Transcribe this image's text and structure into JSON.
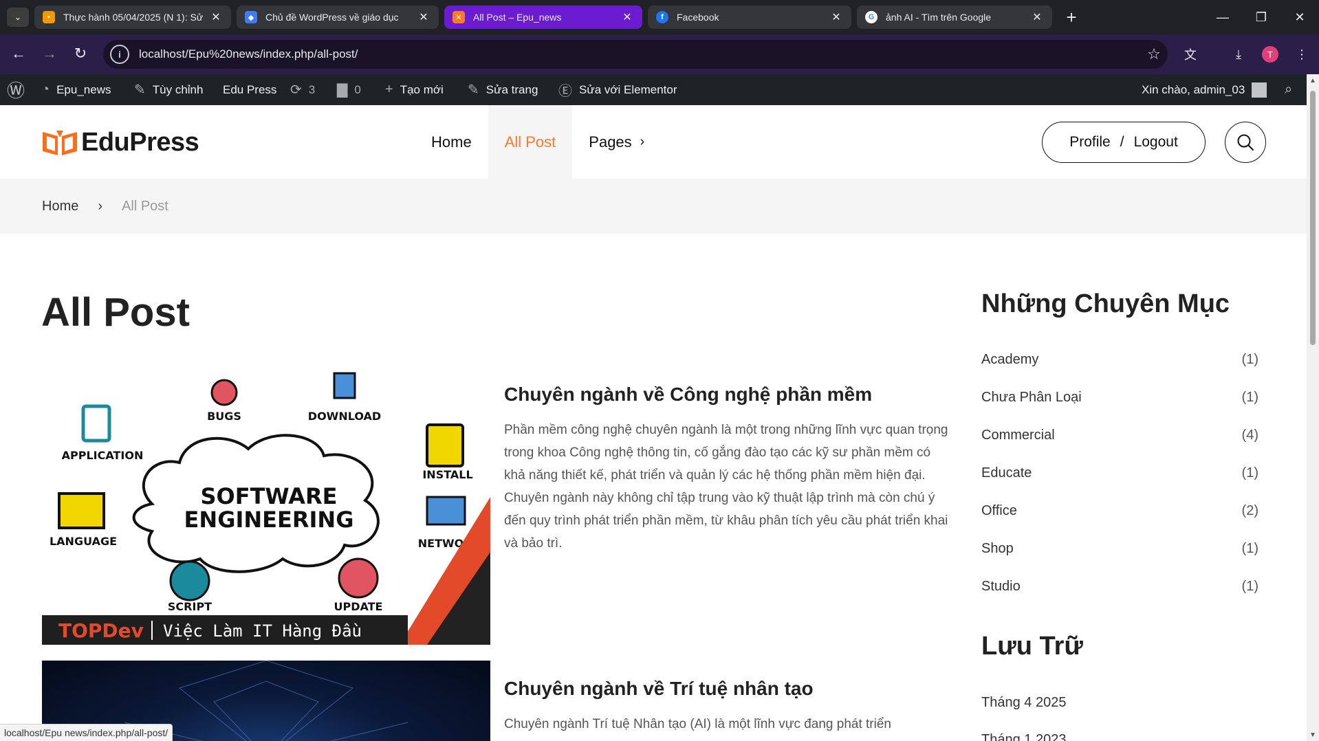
{
  "browser": {
    "tabs": [
      {
        "title": "Thực hành 05/04/2025 (N 1): Sử",
        "favicon": "slides-icon",
        "color": "#f29900"
      },
      {
        "title": "Chủ đề WordPress về giáo dục",
        "favicon": "shield-icon",
        "color": "#3d7cf2"
      },
      {
        "title": "All Post – Epu_news",
        "favicon": "xampp-icon",
        "color": "#fb7a24"
      },
      {
        "title": "Facebook",
        "favicon": "facebook-icon",
        "color": "#1877f2"
      },
      {
        "title": "ảnh AI - Tìm trên Google",
        "favicon": "google-icon",
        "color": "#ffffff"
      }
    ],
    "url": "localhost/Epu%20news/index.php/all-post/",
    "profile_initial": "T",
    "status_url": "localhost/Epu news/index.php/all-post/"
  },
  "adminbar": {
    "site_name": "Epu_news",
    "customize": "Tùy chỉnh",
    "theme": "Edu Press",
    "updates": "3",
    "comments": "0",
    "new": "Tạo mới",
    "edit": "Sửa trang",
    "elementor": "Sửa với Elementor",
    "greeting": "Xin chào, admin_03"
  },
  "header": {
    "logo": "EduPress",
    "nav": [
      "Home",
      "All Post",
      "Pages"
    ],
    "profile": "Profile",
    "slash": "/",
    "logout": "Logout"
  },
  "breadcrumb": {
    "home": "Home",
    "current": "All Post"
  },
  "page_title": "All Post",
  "posts": [
    {
      "title": "Chuyên ngành về Công nghệ phần mềm",
      "excerpt": "Phần mềm công nghệ chuyên ngành là một trong những lĩnh vực quan trọng trong khoa Công nghệ thông tin, cố gắng đào tạo các kỹ sư phần mềm có khả năng thiết kế, phát triển và quản lý các hệ thống phần mềm hiện đại. Chuyên ngành này không chỉ tập trung vào kỹ thuật lập trình mà còn chú ý đến quy trình phát triển phần mềm, từ khâu phân tích yêu cầu phát triển khai và bảo trì.",
      "image": {
        "center_line1": "SOFTWARE",
        "center_line2": "ENGINEERING",
        "labels": [
          "BUGS",
          "DOWNLOAD",
          "APPLICATION",
          "INSTALL",
          "LANGUAGE",
          "NETWO",
          "SCRIPT",
          "UPDATE"
        ],
        "brand": "TOPDev",
        "tagline": "Việc Làm IT Hàng Đầu"
      }
    },
    {
      "title": "Chuyên ngành về Trí tuệ nhân tạo",
      "excerpt": "Chuyên ngành Trí tuệ Nhân tạo (AI) là một lĩnh vực đang phát triển"
    }
  ],
  "sidebar": {
    "categories_title": "Những Chuyên Mục",
    "categories": [
      {
        "name": "Academy",
        "count": "(1)"
      },
      {
        "name": "Chưa Phân Loại",
        "count": "(1)"
      },
      {
        "name": "Commercial",
        "count": "(4)"
      },
      {
        "name": "Educate",
        "count": "(1)"
      },
      {
        "name": "Office",
        "count": "(2)"
      },
      {
        "name": "Shop",
        "count": "(1)"
      },
      {
        "name": "Studio",
        "count": "(1)"
      }
    ],
    "archive_title": "Lưu Trữ",
    "archives": [
      "Tháng 4 2025",
      "Tháng 1 2023"
    ]
  },
  "colors": {
    "accent": "#ff782d",
    "admin_bar": "#1d2327",
    "active_tab": "#6b1bd0"
  }
}
